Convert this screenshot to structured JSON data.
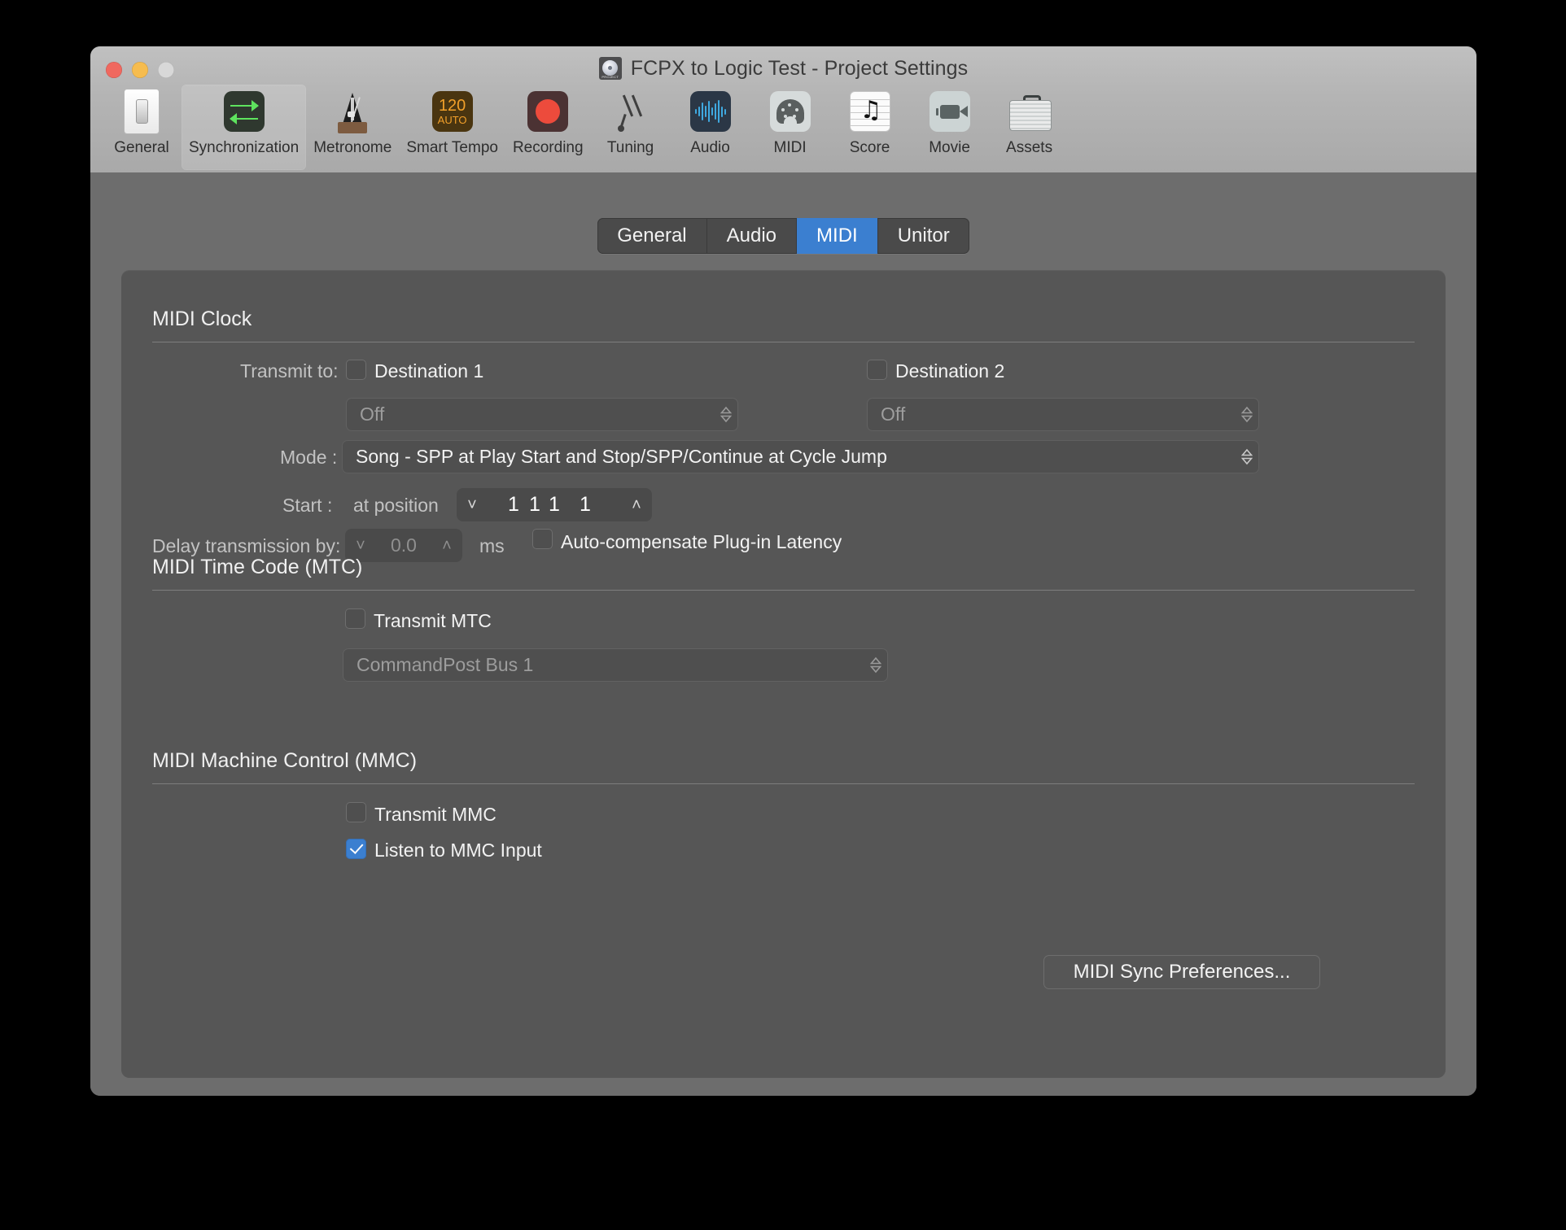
{
  "window": {
    "title": "FCPX to Logic Test - Project Settings",
    "project_badge_label": "PROJECT",
    "traffic_lights": [
      "close",
      "minimize",
      "zoom"
    ]
  },
  "toolbar": {
    "items": [
      {
        "label": "General",
        "icon": "toggle-switch-icon",
        "selected": false
      },
      {
        "label": "Synchronization",
        "icon": "sync-arrows-icon",
        "selected": true
      },
      {
        "label": "Metronome",
        "icon": "metronome-icon",
        "selected": false
      },
      {
        "label": "Smart Tempo",
        "icon": "tempo-120-auto-icon",
        "selected": false,
        "badge_number": "120",
        "badge_text": "AUTO"
      },
      {
        "label": "Recording",
        "icon": "record-dot-icon",
        "selected": false
      },
      {
        "label": "Tuning",
        "icon": "tuning-fork-icon",
        "selected": false
      },
      {
        "label": "Audio",
        "icon": "waveform-icon",
        "selected": false
      },
      {
        "label": "MIDI",
        "icon": "midi-plug-icon",
        "selected": false
      },
      {
        "label": "Score",
        "icon": "music-staff-note-icon",
        "selected": false
      },
      {
        "label": "Movie",
        "icon": "video-camera-icon",
        "selected": false
      },
      {
        "label": "Assets",
        "icon": "briefcase-icon",
        "selected": false
      }
    ]
  },
  "tabs": {
    "items": [
      {
        "label": "General",
        "active": false
      },
      {
        "label": "Audio",
        "active": false
      },
      {
        "label": "MIDI",
        "active": true
      },
      {
        "label": "Unitor",
        "active": false
      }
    ],
    "active_color": "#3b7fd0"
  },
  "midi_clock": {
    "section_title": "MIDI Clock",
    "transmit_to_label": "Transmit to:",
    "destination1": {
      "label": "Destination 1",
      "checked": false,
      "popup_value": "Off",
      "enabled": false
    },
    "destination2": {
      "label": "Destination 2",
      "checked": false,
      "popup_value": "Off",
      "enabled": false
    },
    "mode_label": "Mode :",
    "mode_value": "Song - SPP at Play Start and Stop/SPP/Continue at Cycle Jump",
    "start_label": "Start :",
    "start_at_position_label": "at position",
    "start_position": [
      "1",
      "1",
      "1",
      "1"
    ],
    "delay_label": "Delay transmission by:",
    "delay_value": "0.0",
    "delay_unit": "ms",
    "auto_compensate_label": "Auto-compensate Plug-in Latency",
    "auto_compensate_checked": false
  },
  "mtc": {
    "section_title": "MIDI Time Code (MTC)",
    "transmit_label": "Transmit MTC",
    "transmit_checked": false,
    "destination_value": "CommandPost Bus 1",
    "destination_enabled": false
  },
  "mmc": {
    "section_title": "MIDI Machine Control (MMC)",
    "transmit_label": "Transmit MMC",
    "transmit_checked": false,
    "listen_label": "Listen to MMC Input",
    "listen_checked": true
  },
  "footer": {
    "sync_prefs_button": "MIDI Sync Preferences..."
  }
}
